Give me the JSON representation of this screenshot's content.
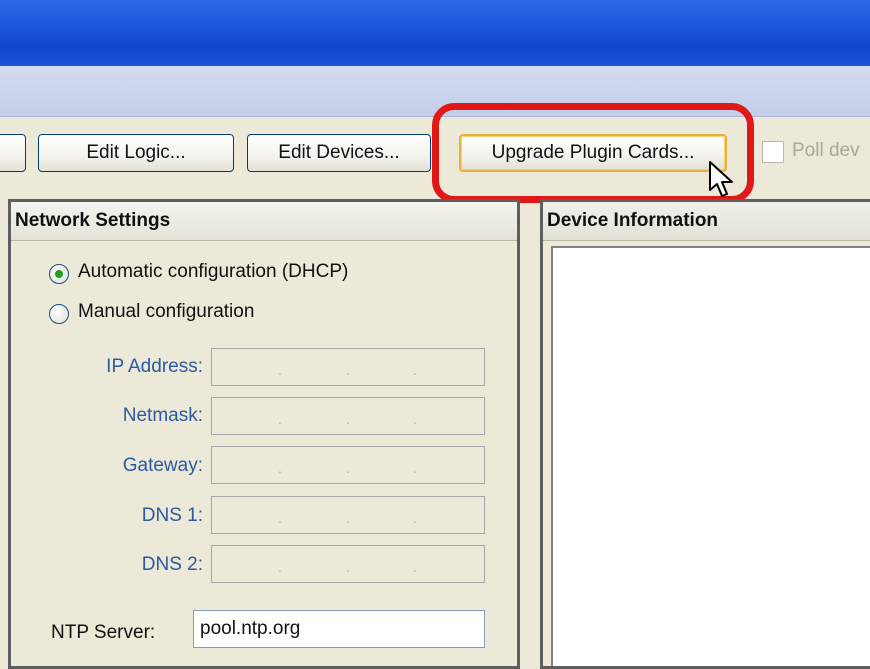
{
  "toolbar": {
    "edit_logic": "Edit Logic...",
    "edit_devices": "Edit Devices...",
    "upgrade_plugin_cards": "Upgrade Plugin Cards...",
    "poll_devices": "Poll dev"
  },
  "network_settings": {
    "title": "Network Settings",
    "dhcp_label": "Automatic configuration (DHCP)",
    "manual_label": "Manual configuration",
    "selected": "dhcp",
    "fields": [
      {
        "label": "IP Address:"
      },
      {
        "label": "Netmask:"
      },
      {
        "label": "Gateway:"
      },
      {
        "label": "DNS 1:"
      },
      {
        "label": "DNS 2:"
      }
    ],
    "ntp_label": "NTP Server:",
    "ntp_value": "pool.ntp.org"
  },
  "device_information": {
    "title": "Device Information"
  },
  "colors": {
    "highlight": "#e01818",
    "titlebar": "#1c56d9",
    "label_blue": "#2a5aa0"
  }
}
